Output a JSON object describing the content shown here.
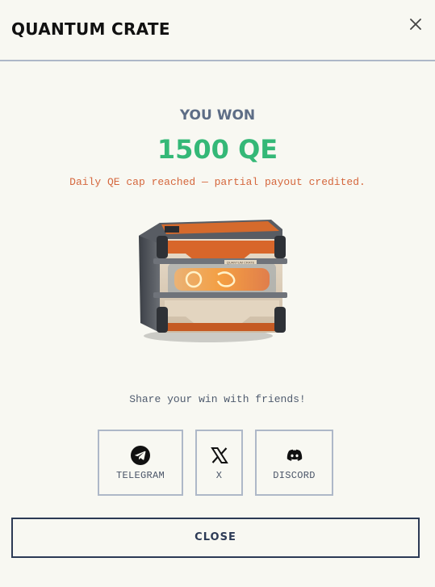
{
  "modal": {
    "title": "QUANTUM CRATE",
    "close_icon": "close-icon"
  },
  "result": {
    "won_label": "YOU WON",
    "amount": "1500 QE",
    "notice": "Daily QE cap reached — partial payout credited.",
    "crate_label": "QUANTUM CRATE"
  },
  "share": {
    "prompt": "Share your win with friends!",
    "buttons": [
      {
        "label": "TELEGRAM",
        "icon": "telegram-icon"
      },
      {
        "label": "X",
        "icon": "x-icon"
      },
      {
        "label": "DISCORD",
        "icon": "discord-icon"
      }
    ]
  },
  "footer": {
    "close_label": "CLOSE"
  },
  "colors": {
    "accent_green": "#34b877",
    "notice_orange": "#d5673d",
    "muted_blue": "#5d6d86",
    "border": "#aeb8c8",
    "dark_navy": "#2c3a55"
  }
}
